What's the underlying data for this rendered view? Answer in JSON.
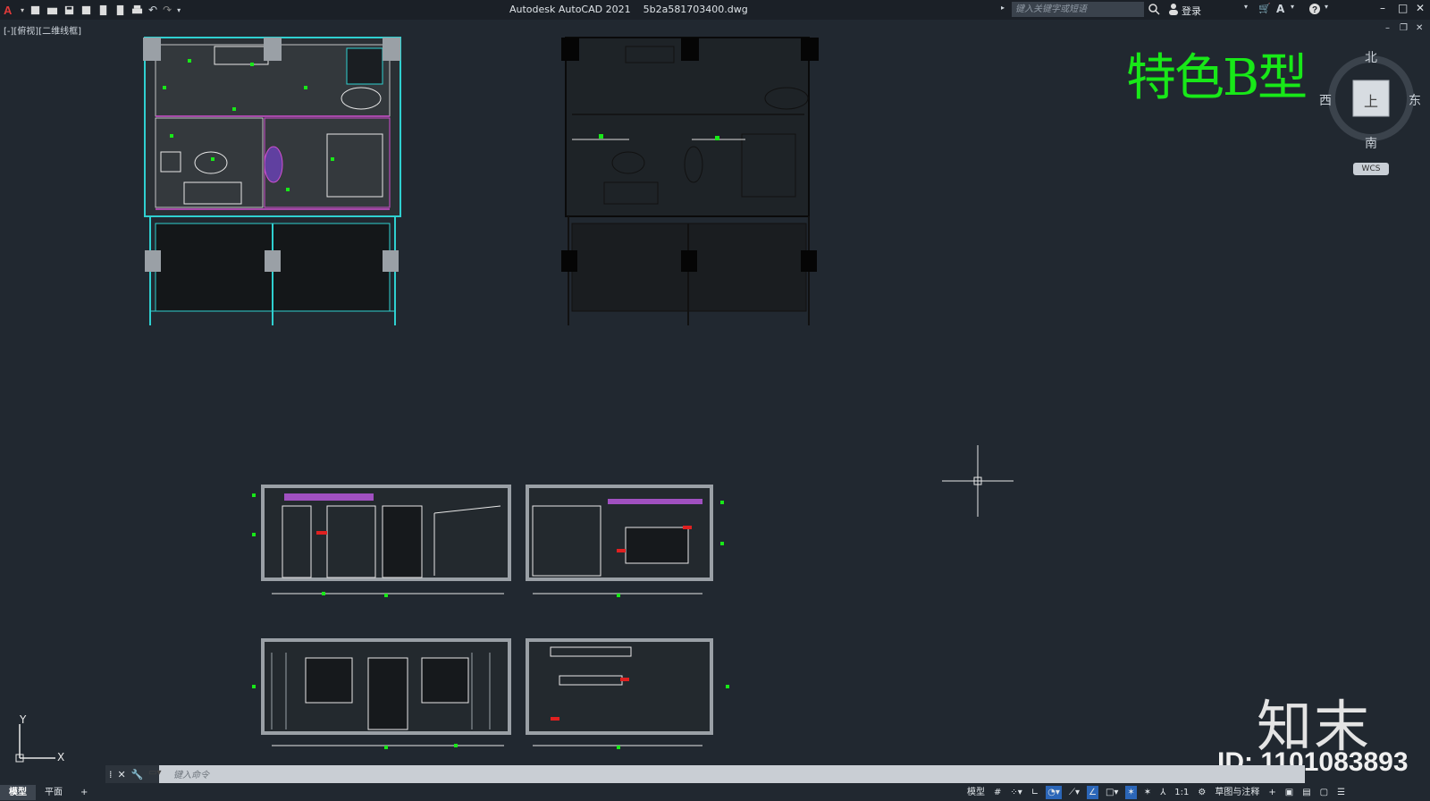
{
  "window": {
    "title": "Autodesk AutoCAD 2021",
    "filename": "5b2a581703400.dwg"
  },
  "search": {
    "placeholder": "键入关键字或短语"
  },
  "user": {
    "login_label": "登录"
  },
  "viewport": {
    "label": "[-][俯视][二维线框]"
  },
  "drawing": {
    "title_label": "特色B型"
  },
  "viewcube": {
    "north": "北",
    "south": "南",
    "east": "东",
    "west": "西",
    "face": "上",
    "wcs_label": "WCS"
  },
  "ucs": {
    "x_label": "X",
    "y_label": "Y"
  },
  "command": {
    "placeholder": "键入命令"
  },
  "tabs": [
    {
      "label": "模型",
      "active": true
    },
    {
      "label": "平面",
      "active": false
    },
    {
      "label": "+",
      "active": false
    }
  ],
  "status": {
    "model_label": "模型",
    "scale_label": "1:1",
    "workspace_label": "草图与注释"
  },
  "watermark": {
    "logo": "知末",
    "id": "ID: 1101083893"
  },
  "colors": {
    "background": "#212830",
    "accent_green": "#18e818",
    "cyan": "#2fd0d0"
  }
}
